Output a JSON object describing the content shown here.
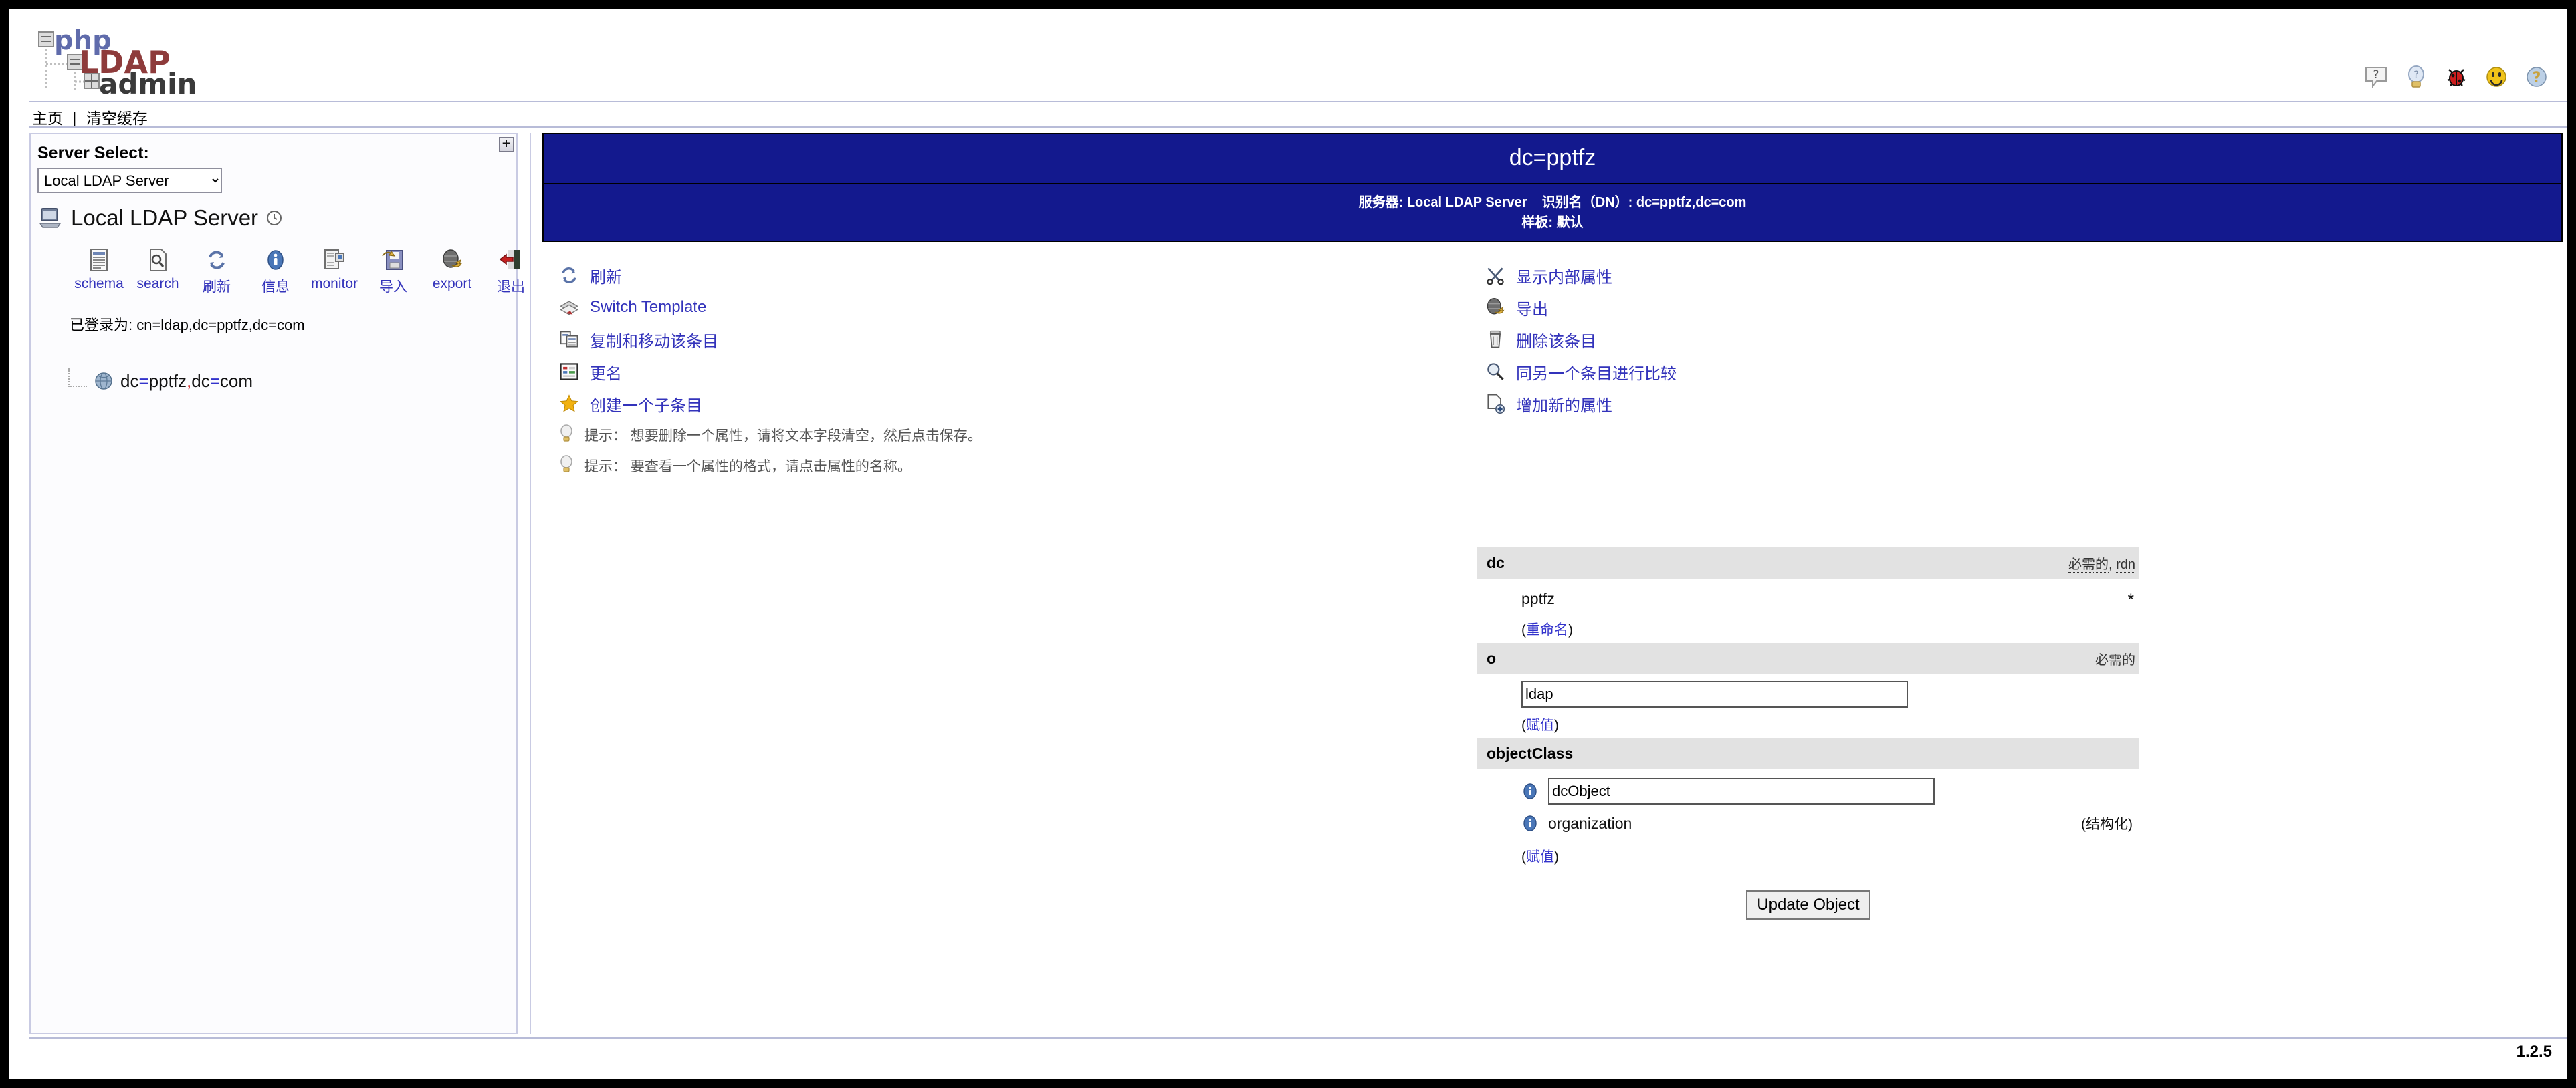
{
  "app": {
    "logo_php": "php",
    "logo_ldap": "LDAP",
    "logo_admin": "admin",
    "version": "1.2.5"
  },
  "header_icons": [
    {
      "name": "help-balloon-icon",
      "glyph": "?"
    },
    {
      "name": "lightbulb-icon",
      "glyph": "?"
    },
    {
      "name": "bug-icon",
      "glyph": "bug"
    },
    {
      "name": "smiley-icon",
      "glyph": ":)"
    },
    {
      "name": "question-sphere-icon",
      "glyph": "?"
    }
  ],
  "breadcrumb": {
    "home": "主页",
    "separator": "|",
    "purge": "清空缓存"
  },
  "sidebar": {
    "collapse_glyph": "+",
    "server_select_label": "Server Select:",
    "server_select_value": "Local LDAP Server",
    "server_select_options": [
      "Local LDAP Server"
    ],
    "server_name": "Local LDAP Server",
    "toolbar": [
      {
        "icon": "schema-icon",
        "label": "schema"
      },
      {
        "icon": "search-icon",
        "label": "search"
      },
      {
        "icon": "refresh-icon",
        "label": "刷新"
      },
      {
        "icon": "info-icon",
        "label": "信息"
      },
      {
        "icon": "monitor-icon",
        "label": "monitor"
      },
      {
        "icon": "import-icon",
        "label": "导入"
      },
      {
        "icon": "export-icon",
        "label": "export"
      },
      {
        "icon": "logout-icon",
        "label": "退出"
      }
    ],
    "logged_in_as": "已登录为: cn=ldap,dc=pptfz,dc=com",
    "tree": [
      {
        "icon": "globe-icon",
        "label_pre": "dc",
        "eq1": "=",
        "mid": "pptfz",
        "comma": ",",
        "label_post": "dc",
        "eq2": "=",
        "tail": "com"
      }
    ]
  },
  "main": {
    "dn_title": "dc=pptfz",
    "server_label": "服务器:",
    "server_value": "Local LDAP Server",
    "dn_label": "识别名（DN）:",
    "dn_value": "dc=pptfz,dc=com",
    "template_line": "样板: 默认",
    "actions_left": [
      {
        "icon": "refresh-icon",
        "label": "刷新"
      },
      {
        "icon": "switch-template-icon",
        "label": "Switch Template"
      },
      {
        "icon": "copy-move-icon",
        "label": "复制和移动该条目"
      },
      {
        "icon": "rename-icon",
        "label": "更名"
      },
      {
        "icon": "star-icon",
        "label": "创建一个子条目"
      }
    ],
    "actions_right": [
      {
        "icon": "tools-icon",
        "label": "显示内部属性"
      },
      {
        "icon": "export-icon",
        "label": "导出"
      },
      {
        "icon": "trash-icon",
        "label": "删除该条目"
      },
      {
        "icon": "compare-icon",
        "label": "同另一个条目进行比较"
      },
      {
        "icon": "add-attr-icon",
        "label": "增加新的属性"
      }
    ],
    "hints": [
      {
        "icon": "lightbulb-icon",
        "text": "提示： 想要删除一个属性，请将文本字段清空，然后点击保存。"
      },
      {
        "icon": "lightbulb-icon",
        "text": "提示： 要查看一个属性的格式，请点击属性的名称。"
      }
    ],
    "attributes": [
      {
        "name": "dc",
        "meta_required": "必需的",
        "meta_sep": ", ",
        "meta_rdn": "rdn",
        "kind": "readonly",
        "value": "pptfz",
        "star": "*",
        "action_open": "(",
        "action_label": "重命名",
        "action_close": ")"
      },
      {
        "name": "o",
        "meta_required": "必需的",
        "meta_sep": "",
        "meta_rdn": "",
        "kind": "input",
        "value": "ldap",
        "star": "",
        "action_open": "(",
        "action_label": "赋值",
        "action_close": ")"
      },
      {
        "name": "objectClass",
        "meta_required": "",
        "meta_sep": "",
        "meta_rdn": "",
        "kind": "objectclass",
        "rows": [
          {
            "icon": "info-icon",
            "kind": "input",
            "value": "dcObject",
            "flag": ""
          },
          {
            "icon": "info-icon",
            "kind": "text",
            "value": "organization",
            "flag": "(结构化)"
          }
        ],
        "action_open": "(",
        "action_label": "赋值",
        "action_close": ")"
      }
    ],
    "submit_label": "Update Object"
  },
  "colors": {
    "header_blue": "#13198e",
    "link_blue": "#3333bb",
    "attr_head_bg": "#e2e2e2",
    "rule": "#b8bcd8"
  }
}
